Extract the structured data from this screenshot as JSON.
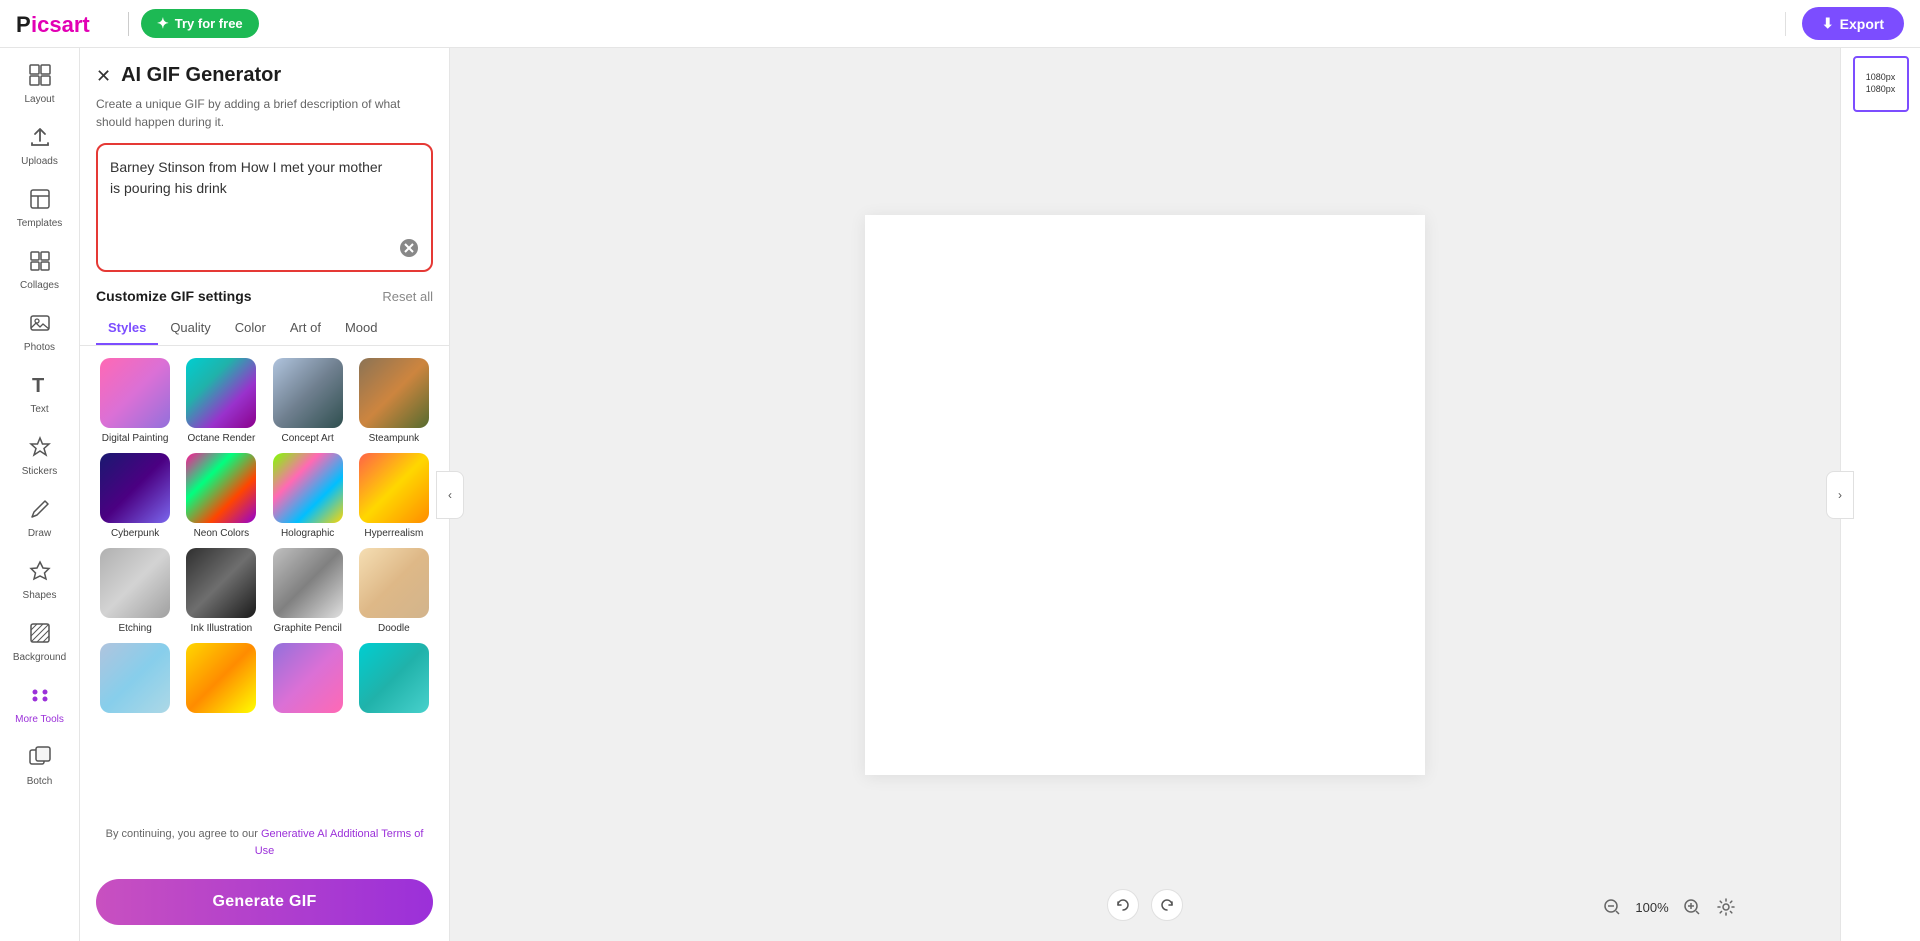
{
  "topbar": {
    "logo_p": "P",
    "logo_icsart": "icsart",
    "try_free_label": "Try for free",
    "export_label": "Export"
  },
  "sidebar": {
    "items": [
      {
        "id": "layout",
        "icon": "⊞",
        "label": "Layout"
      },
      {
        "id": "uploads",
        "icon": "↑",
        "label": "Uploads"
      },
      {
        "id": "templates",
        "icon": "📖",
        "label": "Templates"
      },
      {
        "id": "collages",
        "icon": "⊟",
        "label": "Collages"
      },
      {
        "id": "photos",
        "icon": "🖼",
        "label": "Photos"
      },
      {
        "id": "text",
        "icon": "T",
        "label": "Text"
      },
      {
        "id": "stickers",
        "icon": "✦",
        "label": "Stickers"
      },
      {
        "id": "draw",
        "icon": "✏",
        "label": "Draw"
      },
      {
        "id": "shapes",
        "icon": "★",
        "label": "Shapes"
      },
      {
        "id": "background",
        "icon": "▦",
        "label": "Background"
      },
      {
        "id": "more-tools",
        "icon": "⁝⁝",
        "label": "More Tools"
      },
      {
        "id": "batch",
        "icon": "⊞",
        "label": "Botch"
      }
    ]
  },
  "panel": {
    "title": "AI GIF Generator",
    "subtitle": "Create a unique GIF by adding a brief description of what should happen during it.",
    "prompt_text": "Barney Stinson from How I met your mother is pouring his drink",
    "customize_title": "Customize GIF settings",
    "reset_label": "Reset all",
    "tabs": [
      {
        "id": "styles",
        "label": "Styles",
        "active": true
      },
      {
        "id": "quality",
        "label": "Quality"
      },
      {
        "id": "color",
        "label": "Color"
      },
      {
        "id": "art-of",
        "label": "Art of"
      },
      {
        "id": "mood",
        "label": "Mood"
      }
    ],
    "styles": [
      {
        "id": "digital-painting",
        "label": "Digital Painting",
        "thumb": "digital"
      },
      {
        "id": "octane-render",
        "label": "Octane Render",
        "thumb": "octane"
      },
      {
        "id": "concept-art",
        "label": "Concept Art",
        "thumb": "concept"
      },
      {
        "id": "steampunk",
        "label": "Steampunk",
        "thumb": "steampunk"
      },
      {
        "id": "cyberpunk",
        "label": "Cyberpunk",
        "thumb": "cyberpunk"
      },
      {
        "id": "neon-colors",
        "label": "Neon Colors",
        "thumb": "neon"
      },
      {
        "id": "holographic",
        "label": "Holographic",
        "thumb": "holographic"
      },
      {
        "id": "hyperrealism",
        "label": "Hyperrealism",
        "thumb": "hyperrealism"
      },
      {
        "id": "etching",
        "label": "Etching",
        "thumb": "etching"
      },
      {
        "id": "ink-illustration",
        "label": "Ink Illustration",
        "thumb": "ink"
      },
      {
        "id": "graphite-pencil",
        "label": "Graphite Pencil",
        "thumb": "graphite"
      },
      {
        "id": "doodle",
        "label": "Doodle",
        "thumb": "doodle"
      },
      {
        "id": "row4a",
        "label": "",
        "thumb": "row4a"
      },
      {
        "id": "row4b",
        "label": "",
        "thumb": "row4b"
      },
      {
        "id": "row4c",
        "label": "",
        "thumb": "row4c"
      },
      {
        "id": "row4d",
        "label": "",
        "thumb": "row4d"
      }
    ],
    "disclaimer": "By continuing, you agree to our ",
    "disclaimer_link": "Generative AI Additional Terms of Use",
    "generate_label": "Generate GIF"
  },
  "canvas": {
    "size_label": "1080px\n1080px",
    "size_line1": "1080px",
    "size_line2": "1080px"
  },
  "zoom": {
    "value": "100%"
  }
}
